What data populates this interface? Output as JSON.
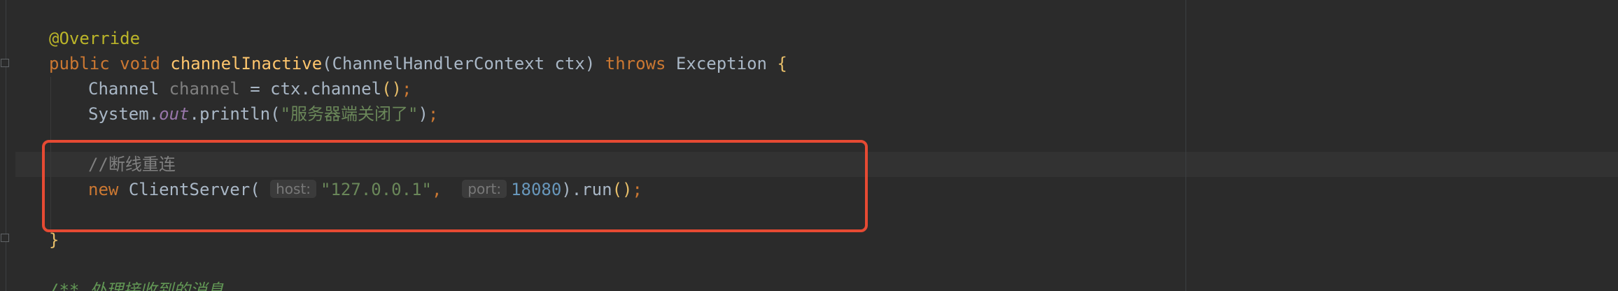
{
  "code": {
    "line1": {
      "annotation": "@Override"
    },
    "line2": {
      "modifier": "public",
      "return_type": "void",
      "method_name": "channelInactive",
      "open_paren": "(",
      "param_type": "ChannelHandlerContext",
      "param_name": "ctx",
      "close_paren": ")",
      "throws_kw": "throws",
      "exception": "Exception",
      "open_brace": "{"
    },
    "line3": {
      "type": "Channel",
      "var": "channel",
      "assign": "=",
      "expr": "ctx.channel",
      "call": "()",
      "semi": ";"
    },
    "line4": {
      "cls": "System.",
      "field": "out",
      "method": ".println(",
      "string": "\"服务器端关闭了\"",
      "end": ")",
      "semi": ";"
    },
    "line6": {
      "comment": "//断线重连"
    },
    "line7": {
      "new_kw": "new",
      "cls": "ClientServer(",
      "hint_host": "host:",
      "host_val": "\"127.0.0.1\"",
      "comma": ",",
      "hint_port": "port:",
      "port_val": "18080",
      "close": ").run",
      "call": "()",
      "semi": ";"
    },
    "line9": {
      "close_brace": "}"
    },
    "line11": {
      "doc_comment": "/** 处理接收到的消息"
    }
  },
  "colors": {
    "background": "#2b2b2b",
    "highlight_border": "#e64a33",
    "keyword": "#cc7832",
    "annotation": "#bbb529",
    "string": "#6a8759",
    "number": "#6897bb"
  }
}
